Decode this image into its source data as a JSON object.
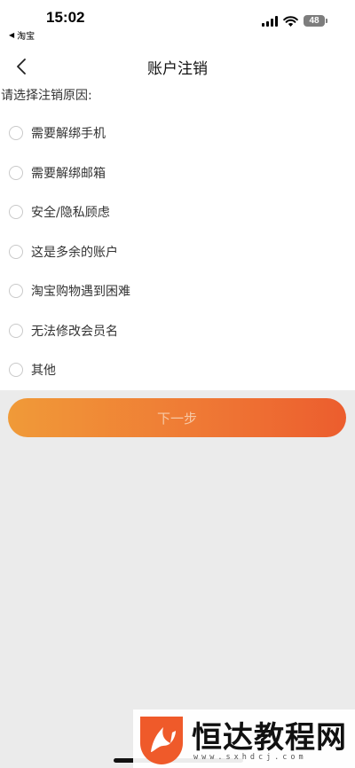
{
  "status_bar": {
    "time": "15:02",
    "back_app_label": "淘宝",
    "battery": "48"
  },
  "nav": {
    "title": "账户注销"
  },
  "form": {
    "prompt": "请选择注销原因:",
    "options": [
      {
        "label": "需要解绑手机",
        "selected": false
      },
      {
        "label": "需要解绑邮箱",
        "selected": false
      },
      {
        "label": "安全/隐私顾虑",
        "selected": false
      },
      {
        "label": "这是多余的账户",
        "selected": false
      },
      {
        "label": "淘宝购物遇到困难",
        "selected": false
      },
      {
        "label": "无法修改会员名",
        "selected": false
      },
      {
        "label": "其他",
        "selected": false
      }
    ],
    "next_label": "下一步"
  },
  "watermark": {
    "text": "恒达教程网",
    "url": "www.sxhdcj.com"
  },
  "colors": {
    "button_gradient_start": "#f09a38",
    "button_gradient_end": "#ec5d2e",
    "background": "#ebebeb",
    "logo_orange": "#ef5a2a"
  }
}
